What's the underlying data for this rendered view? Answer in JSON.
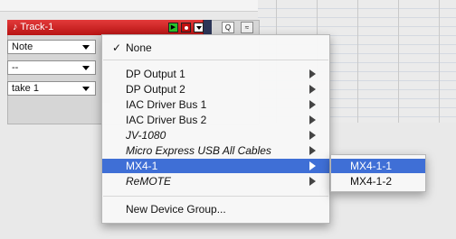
{
  "track": {
    "name": "Track-1",
    "note_glyph": "♪",
    "play_glyph": "▶",
    "search_glyph": "Q",
    "wave_glyph": "≈"
  },
  "dropdowns": {
    "note": "Note",
    "dash": "--",
    "take": "take 1"
  },
  "menu": {
    "none_check": "✓",
    "none_label": "None",
    "items": [
      {
        "label": "DP Output 1",
        "italic": false
      },
      {
        "label": "DP Output 2",
        "italic": false
      },
      {
        "label": "IAC Driver Bus 1",
        "italic": false
      },
      {
        "label": "IAC Driver Bus 2",
        "italic": false
      },
      {
        "label": "JV-1080",
        "italic": true
      },
      {
        "label": "Micro Express USB All Cables",
        "italic": true
      },
      {
        "label": "MX4-1",
        "italic": false
      },
      {
        "label": "ReMOTE",
        "italic": true
      }
    ],
    "footer_label": "New Device Group...",
    "selected": "MX4-1"
  },
  "submenu": {
    "items": [
      "MX4-1-1",
      "MX4-1-2"
    ],
    "selected": "MX4-1-1"
  },
  "colors": {
    "track_red": "#d22424",
    "menu_highlight": "#3f6fd6"
  }
}
